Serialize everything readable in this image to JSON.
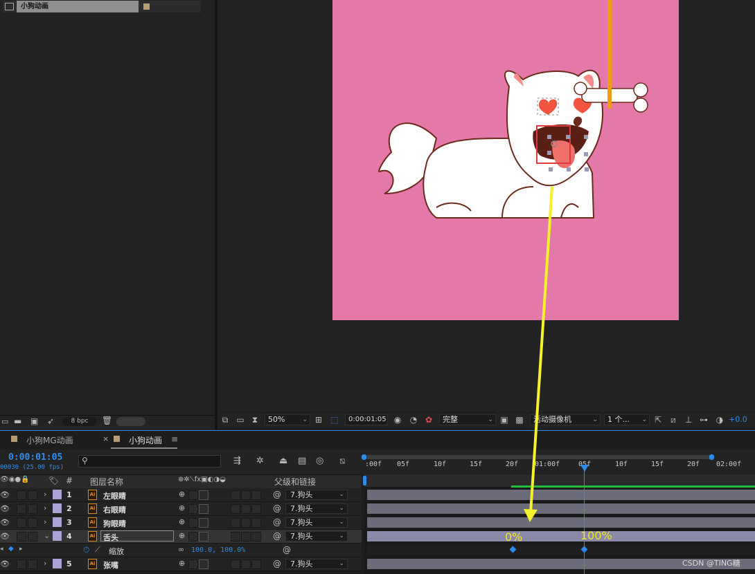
{
  "project": {
    "selected_item": "小狗动画",
    "bpc": "8 bpc"
  },
  "comp_toolbar": {
    "zoom": "50%",
    "timecode": "0:00:01:05",
    "resolution": "完整",
    "camera": "活动摄像机",
    "views": "1 个...",
    "exposure": "+0.0"
  },
  "tabs": [
    {
      "label": "小狗MG动画"
    },
    {
      "label": "小狗动画"
    }
  ],
  "timeline": {
    "timecode": "0:00:01:05",
    "fps": "00030 (25.00 fps)",
    "search_placeholder": "",
    "ruler": [
      ":00f",
      "05f",
      "10f",
      "15f",
      "20f",
      "01:00f",
      "05f",
      "10f",
      "15f",
      "20f",
      "02:00f"
    ],
    "columns": {
      "num": "#",
      "layer_name": "图层名称",
      "parent": "父级和链接"
    },
    "layers": [
      {
        "num": "1",
        "name": "左眼睛",
        "parent": "7.狗头"
      },
      {
        "num": "2",
        "name": "右眼睛",
        "parent": "7.狗头"
      },
      {
        "num": "3",
        "name": "狗眼睛",
        "parent": "7.狗头"
      },
      {
        "num": "4",
        "name": "舌头",
        "parent": "7.狗头"
      },
      {
        "num": "5",
        "name": "张嘴",
        "parent": "7.狗头"
      }
    ],
    "property": {
      "name": "缩放",
      "value": "100.0, 100.0%"
    },
    "annotations": {
      "start": "0%",
      "end": "100%"
    }
  },
  "watermark": "CSDN @TING糖",
  "colors": {
    "accent": "#2d8ceb",
    "canvas": "#e479a9",
    "annotation": "#f4e52f"
  }
}
